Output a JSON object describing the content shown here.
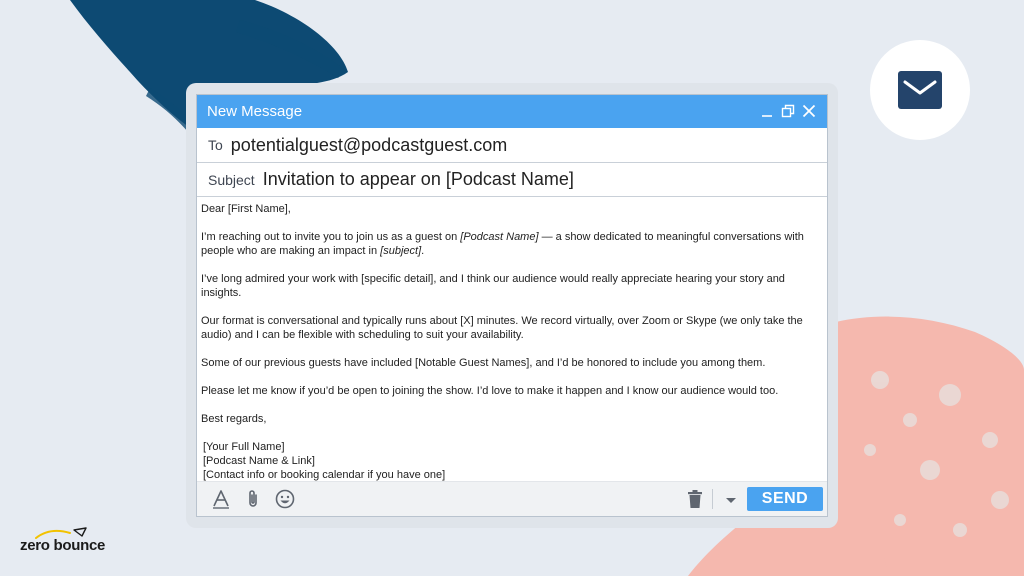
{
  "colors": {
    "background": "#e6ebf2",
    "accent_blue": "#4aa3f0",
    "brush_navy": "#0d4a73",
    "brush_coral": "#f5b8ae",
    "envelope_navy": "#24446b"
  },
  "badge": {
    "icon": "envelope-icon"
  },
  "window": {
    "title": "New Message",
    "controls": [
      "minimize-icon",
      "restore-icon",
      "close-icon"
    ]
  },
  "compose": {
    "to_label": "To",
    "to_value": "potentialguest@podcastguest.com",
    "subject_label": "Subject",
    "subject_value": "Invitation to appear on [Podcast Name]"
  },
  "body": {
    "greeting": "Dear [First Name],",
    "p1_a": "I’m reaching out to invite you to join us as a guest on ",
    "p1_em1": "[Podcast Name]",
    "p1_b": " — a show dedicated to meaningful conversations with people who are making an impact in ",
    "p1_em2": "[subject]",
    "p1_c": ".",
    "p2": "I’ve long admired your work with [specific detail], and I think our audience would really appreciate hearing your story and insights.",
    "p3": "Our format is conversational and typically runs about [X] minutes. We record virtually, over Zoom or Skype (we only take the audio) and I can be flexible with scheduling to suit your availability.",
    "p4": "Some of our previous guests have included [Notable Guest Names], and I’d be honored to include you among them.",
    "p5": "Please let me know if you’d be open to joining the show. I’d love to make it happen and I know our audience would too.",
    "closing": "Best regards,",
    "sig1": "[Your Full Name]",
    "sig2": "[Podcast Name & Link]",
    "sig3": "[Contact info or booking calendar if you have one]"
  },
  "toolbar": {
    "icons": [
      "text-format-icon",
      "attach-icon",
      "emoji-icon",
      "trash-icon",
      "dropdown-icon"
    ],
    "send_label": "SEND"
  },
  "logo": {
    "text": "zero bounce"
  }
}
